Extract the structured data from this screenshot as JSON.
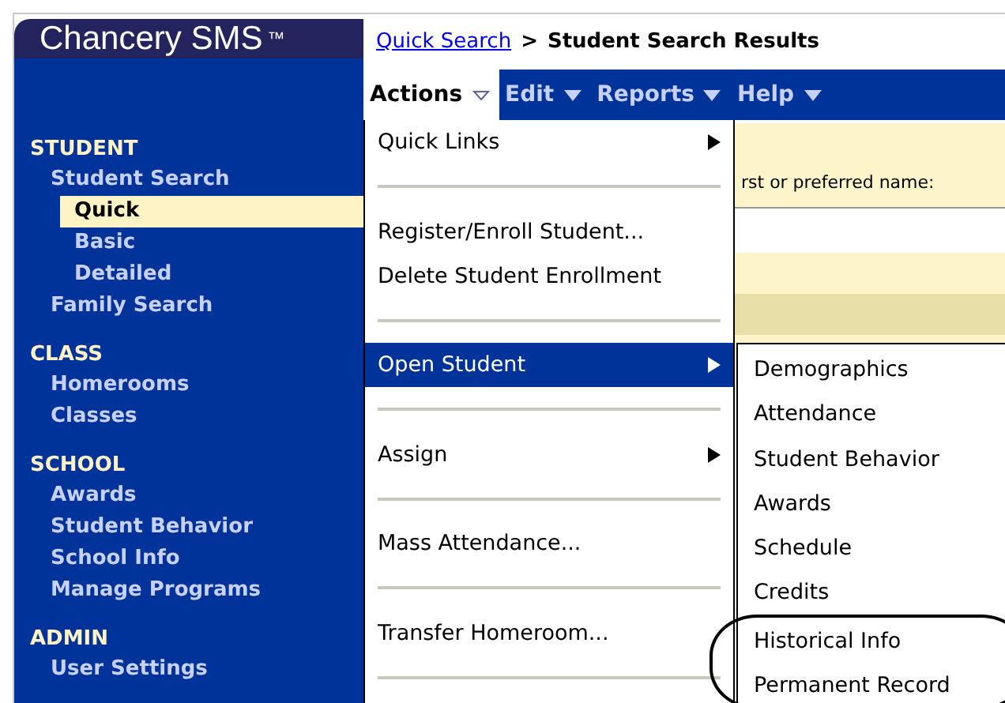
{
  "app": {
    "logo": "Chancery SMS",
    "trademark": "™"
  },
  "breadcrumb": {
    "link": "Quick Search",
    "separator": ">",
    "current": "Student Search Results"
  },
  "menubar": [
    {
      "label": "Actions",
      "selected": true
    },
    {
      "label": "Edit",
      "selected": false
    },
    {
      "label": "Reports",
      "selected": false
    },
    {
      "label": "Help",
      "selected": false
    }
  ],
  "sidebar": [
    {
      "heading": "STUDENT",
      "items": [
        {
          "label": "Student Search",
          "selected": false,
          "children": [
            {
              "label": "Quick",
              "selected": true
            },
            {
              "label": "Basic",
              "selected": false
            },
            {
              "label": "Detailed",
              "selected": false
            }
          ]
        },
        {
          "label": "Family Search",
          "selected": false
        }
      ]
    },
    {
      "heading": "CLASS",
      "items": [
        {
          "label": "Homerooms",
          "selected": false
        },
        {
          "label": "Classes",
          "selected": false
        }
      ]
    },
    {
      "heading": "SCHOOL",
      "items": [
        {
          "label": "Awards",
          "selected": false
        },
        {
          "label": "Student Behavior",
          "selected": false
        },
        {
          "label": "School Info",
          "selected": false
        },
        {
          "label": "Manage Programs",
          "selected": false
        }
      ]
    },
    {
      "heading": "ADMIN",
      "items": [
        {
          "label": "User Settings",
          "selected": false
        }
      ]
    }
  ],
  "content": {
    "search_label": "rst or preferred name:"
  },
  "actions_menu": [
    {
      "kind": "item",
      "label": "Quick Links",
      "has_submenu": true,
      "selected": false
    },
    {
      "kind": "separator"
    },
    {
      "kind": "item",
      "label": "Register/Enroll Student...",
      "has_submenu": false,
      "selected": false
    },
    {
      "kind": "item",
      "label": "Delete Student Enrollment",
      "has_submenu": false,
      "selected": false
    },
    {
      "kind": "separator"
    },
    {
      "kind": "item",
      "label": "Open Student",
      "has_submenu": true,
      "selected": true
    },
    {
      "kind": "separator"
    },
    {
      "kind": "item",
      "label": "Assign",
      "has_submenu": true,
      "selected": false
    },
    {
      "kind": "separator"
    },
    {
      "kind": "item",
      "label": "Mass Attendance...",
      "has_submenu": false,
      "selected": false
    },
    {
      "kind": "separator"
    },
    {
      "kind": "item",
      "label": "Transfer Homeroom...",
      "has_submenu": false,
      "selected": false
    },
    {
      "kind": "separator"
    }
  ],
  "open_student_submenu": [
    {
      "label": "Demographics",
      "circled": false
    },
    {
      "label": "Attendance",
      "circled": false
    },
    {
      "label": "Student Behavior",
      "circled": false
    },
    {
      "label": "Awards",
      "circled": false
    },
    {
      "label": "Schedule",
      "circled": false
    },
    {
      "label": "Credits",
      "circled": false
    },
    {
      "label": "Historical Info",
      "circled": true
    },
    {
      "label": "Permanent Record",
      "circled": true
    }
  ]
}
